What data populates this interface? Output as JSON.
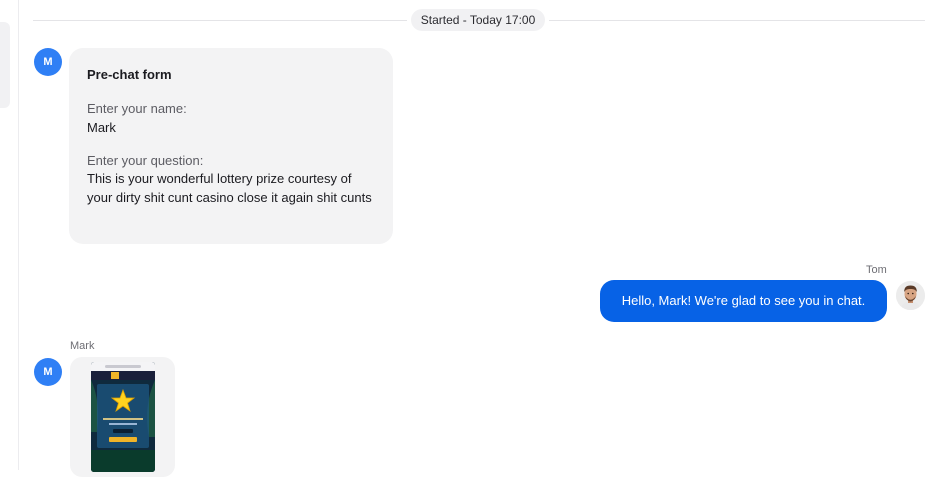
{
  "divider": {
    "label": "Started - Today 17:00"
  },
  "messages": [
    {
      "sender_initial": "M",
      "form": {
        "title": "Pre-chat form",
        "name_label": "Enter your name:",
        "name_value": "Mark",
        "question_label": "Enter your question:",
        "question_value": "This is your wonderful lottery prize courtesy of your dirty shit cunt casino close it again shit cunts"
      }
    },
    {
      "sender_name": "Tom",
      "text": "Hello, Mark! We're glad to see you in chat."
    },
    {
      "sender_name": "Mark",
      "sender_initial": "M",
      "attachment": {
        "icon": "star-icon"
      }
    }
  ],
  "colors": {
    "customer_avatar": "#2f7ff5",
    "agent_bubble": "#0762e6",
    "bubble_bg": "#f3f3f4"
  }
}
